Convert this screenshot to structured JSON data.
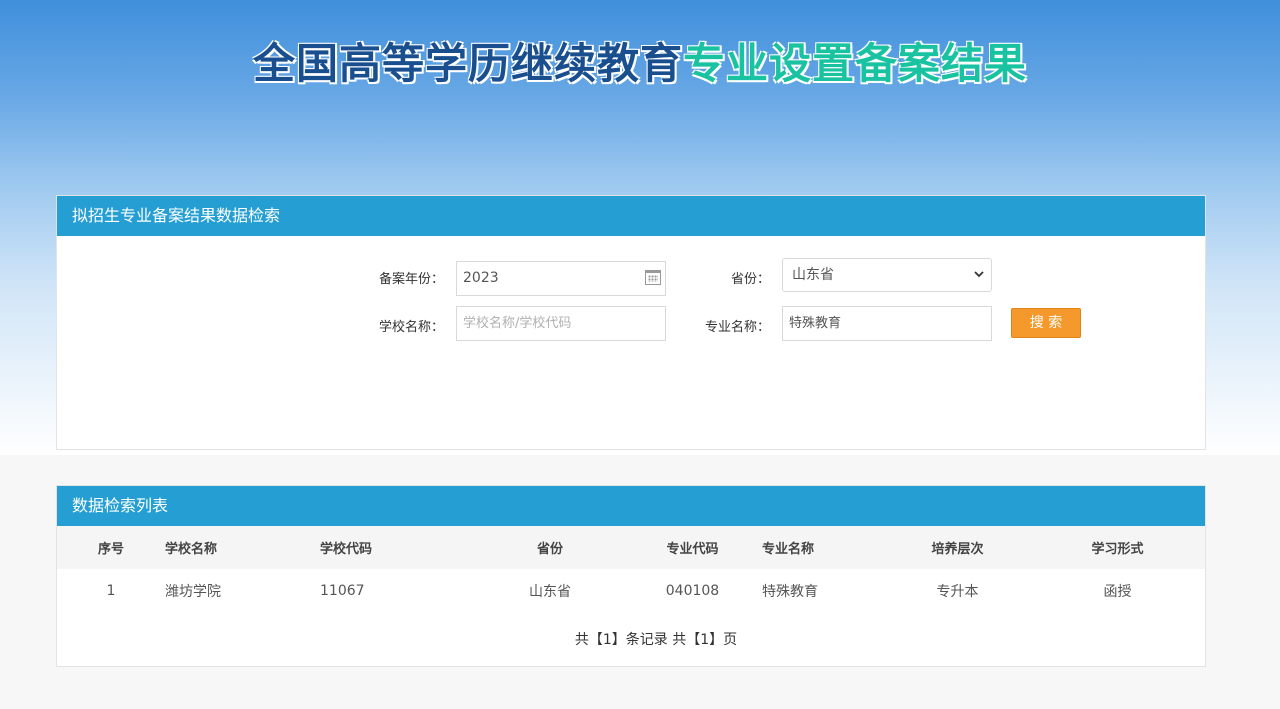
{
  "hero": {
    "title_part1": "全国高等学历继续教育",
    "title_part2": "专业设置备案结果"
  },
  "search_panel": {
    "title": "拟招生专业备案结果数据检索",
    "year_label": "备案年份：",
    "year_value": "2023",
    "province_label": "省份：",
    "province_value": "山东省",
    "school_label": "学校名称：",
    "school_placeholder": "学校名称/学校代码",
    "major_label": "专业名称：",
    "major_value": "特殊教育",
    "search_button": "搜 索"
  },
  "list_panel": {
    "title": "数据检索列表",
    "columns": [
      "序号",
      "学校名称",
      "学校代码",
      "省份",
      "专业代码",
      "专业名称",
      "培养层次",
      "学习形式"
    ],
    "rows": [
      [
        "1",
        "潍坊学院",
        "11067",
        "山东省",
        "040108",
        "特殊教育",
        "专升本",
        "函授"
      ]
    ],
    "pager": "共【1】条记录 共【1】页"
  },
  "colors": {
    "panel_header": "#259fd3",
    "search_button": "#f6992d",
    "title_dark": "#1a4f8f",
    "title_accent": "#19c2a0"
  },
  "icons": {
    "year_field": "calendar-icon",
    "province_field": "chevron-down-icon"
  }
}
